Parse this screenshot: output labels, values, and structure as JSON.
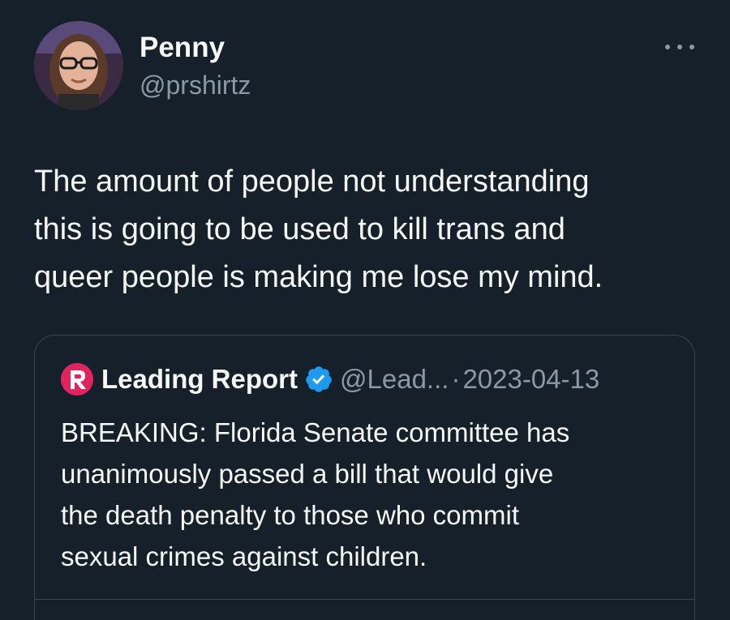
{
  "author": {
    "display_name": "Penny",
    "handle": "@prshirtz"
  },
  "tweet": {
    "text": "The amount of people not understanding\nthis is going to be used to kill trans and\nqueer people is making me lose my mind."
  },
  "quoted_tweet": {
    "display_name": "Leading Report",
    "verified": true,
    "handle": "@Lead...",
    "separator": "·",
    "date": "2023-04-13",
    "text": "BREAKING: Florida Senate committee has\nunanimously passed a bill that would give\nthe death penalty to those who commit\nsexual crimes against children.",
    "logo_color": "#e0245e"
  },
  "icons": {
    "more": "more-horizontal-icon",
    "verified": "verified-badge-icon",
    "logo": "leading-report-logo-icon"
  },
  "colors": {
    "background": "#15202b",
    "primary_text": "#f7f9f9",
    "secondary_text": "#8b98a5",
    "border": "#38444d",
    "verified_blue": "#1d9bf0"
  }
}
